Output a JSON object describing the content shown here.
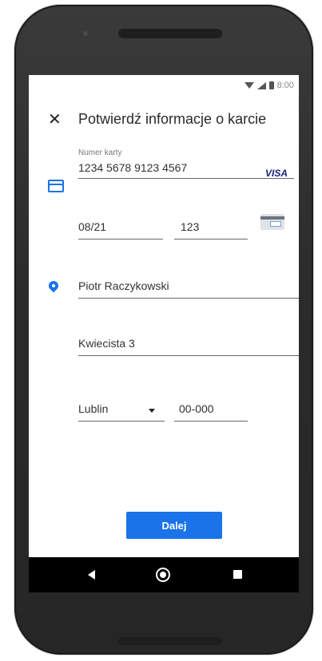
{
  "status_bar": {
    "time": "8:00"
  },
  "header": {
    "title": "Potwierdź informacje o karcie"
  },
  "card": {
    "number_label": "Numer karty",
    "number_value": "1234 5678 9123 4567",
    "brand": "VISA",
    "expiry": "08/21",
    "cvc": "123"
  },
  "address": {
    "name": "Piotr Raczykowski",
    "street": "Kwiecista 3",
    "city": "Lublin",
    "postal_code": "00-000"
  },
  "actions": {
    "next_label": "Dalej"
  },
  "colors": {
    "accent": "#1a73e8",
    "brand_text": "#1a237e"
  }
}
